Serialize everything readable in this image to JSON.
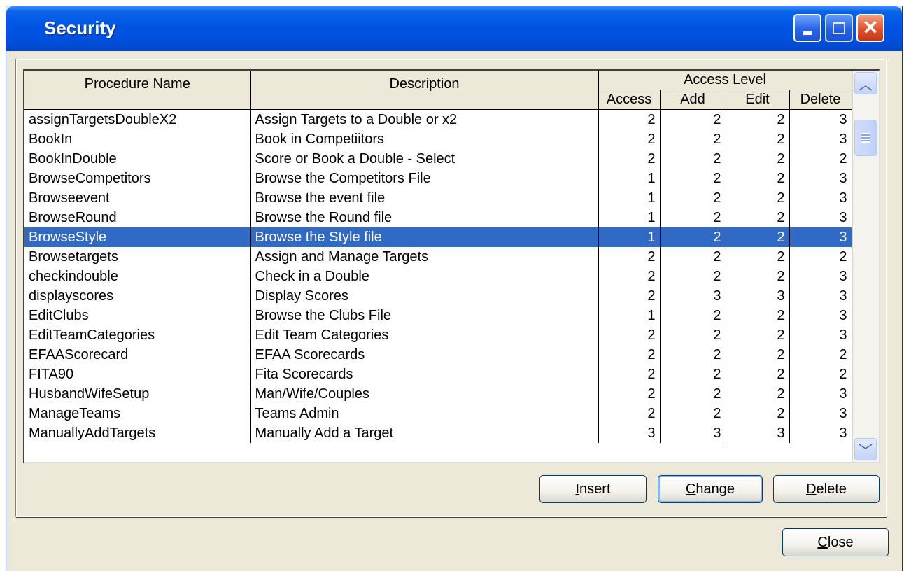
{
  "window": {
    "title": "Security"
  },
  "table": {
    "columns": {
      "procedure": "Procedure Name",
      "description": "Description",
      "access_level": "Access Level",
      "access": "Access",
      "add": "Add",
      "edit": "Edit",
      "delete": "Delete"
    },
    "selected_index": 6,
    "rows": [
      {
        "name": "assignTargetsDoubleX2",
        "desc": "Assign Targets to a Double or x2",
        "access": "2",
        "add": "2",
        "edit": "2",
        "delete": "3"
      },
      {
        "name": "BookIn",
        "desc": "Book in Competiitors",
        "access": "2",
        "add": "2",
        "edit": "2",
        "delete": "3"
      },
      {
        "name": "BookInDouble",
        "desc": "Score or Book a Double - Select",
        "access": "2",
        "add": "2",
        "edit": "2",
        "delete": "2"
      },
      {
        "name": "BrowseCompetitors",
        "desc": "Browse the Competitors File",
        "access": "1",
        "add": "2",
        "edit": "2",
        "delete": "3"
      },
      {
        "name": "Browseevent",
        "desc": "Browse the event file",
        "access": "1",
        "add": "2",
        "edit": "2",
        "delete": "3"
      },
      {
        "name": "BrowseRound",
        "desc": "Browse the Round file",
        "access": "1",
        "add": "2",
        "edit": "2",
        "delete": "3"
      },
      {
        "name": "BrowseStyle",
        "desc": "Browse the Style file",
        "access": "1",
        "add": "2",
        "edit": "2",
        "delete": "3"
      },
      {
        "name": "Browsetargets",
        "desc": "Assign and Manage Targets",
        "access": "2",
        "add": "2",
        "edit": "2",
        "delete": "2"
      },
      {
        "name": "checkindouble",
        "desc": "Check in a Double",
        "access": "2",
        "add": "2",
        "edit": "2",
        "delete": "3"
      },
      {
        "name": "displayscores",
        "desc": "Display Scores",
        "access": "2",
        "add": "3",
        "edit": "3",
        "delete": "3"
      },
      {
        "name": "EditClubs",
        "desc": "Browse the Clubs File",
        "access": "1",
        "add": "2",
        "edit": "2",
        "delete": "3"
      },
      {
        "name": "EditTeamCategories",
        "desc": "Edit Team Categories",
        "access": "2",
        "add": "2",
        "edit": "2",
        "delete": "3"
      },
      {
        "name": "EFAAScorecard",
        "desc": "EFAA Scorecards",
        "access": "2",
        "add": "2",
        "edit": "2",
        "delete": "2"
      },
      {
        "name": "FITA90",
        "desc": "Fita Scorecards",
        "access": "2",
        "add": "2",
        "edit": "2",
        "delete": "2"
      },
      {
        "name": "HusbandWifeSetup",
        "desc": "Man/Wife/Couples",
        "access": "2",
        "add": "2",
        "edit": "2",
        "delete": "3"
      },
      {
        "name": "ManageTeams",
        "desc": "Teams Admin",
        "access": "2",
        "add": "2",
        "edit": "2",
        "delete": "3"
      },
      {
        "name": "ManuallyAddTargets",
        "desc": "Manually Add a Target",
        "access": "3",
        "add": "3",
        "edit": "3",
        "delete": "3"
      }
    ]
  },
  "buttons": {
    "insert": {
      "accel": "I",
      "rest": "nsert"
    },
    "change": {
      "accel": "C",
      "rest": "hange"
    },
    "delete": {
      "accel": "D",
      "rest": "elete"
    },
    "close": {
      "accel": "C",
      "rest": "lose"
    }
  },
  "icons": {
    "minimize": "minimize-icon",
    "maximize": "maximize-icon",
    "close": "close-icon",
    "scroll_up": "chevron-up-icon",
    "scroll_down": "chevron-down-icon"
  },
  "colors": {
    "titlebar": "#0054e3",
    "selection": "#316ac5",
    "dialog_bg": "#ece9d8"
  }
}
